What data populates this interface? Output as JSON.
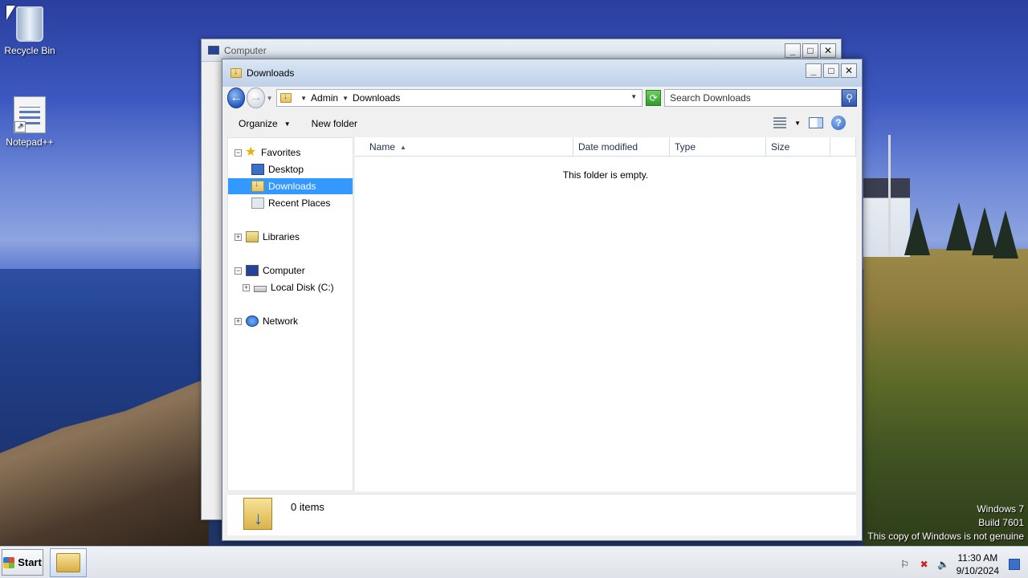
{
  "desktop": {
    "icons": [
      {
        "label": "Recycle Bin",
        "icon": "recycle-bin-icon"
      },
      {
        "label": "Notepad++",
        "icon": "notepad-plus-plus-icon"
      }
    ]
  },
  "background_window": {
    "title": "Computer"
  },
  "window": {
    "title": "Downloads",
    "breadcrumb": [
      "Admin",
      "Downloads"
    ],
    "search_placeholder": "Search Downloads",
    "toolbar": {
      "organize_label": "Organize",
      "new_folder_label": "New folder"
    },
    "nav_tree": {
      "favorites": "Favorites",
      "desktop": "Desktop",
      "downloads": "Downloads",
      "recent_places": "Recent Places",
      "libraries": "Libraries",
      "computer": "Computer",
      "local_disk": "Local Disk (C:)",
      "network": "Network"
    },
    "columns": [
      "Name",
      "Date modified",
      "Type",
      "Size"
    ],
    "empty_message": "This folder is empty.",
    "details": {
      "item_count": "0 items"
    }
  },
  "watermark": {
    "line1": "Windows 7",
    "line2": "Build 7601",
    "line3": "This copy of Windows is not genuine"
  },
  "taskbar": {
    "start_label": "Start",
    "time": "11:30 AM",
    "date": "9/10/2024"
  },
  "colors": {
    "selection": "#3399ff",
    "title_bar": "#c9d9ee",
    "taskbar": "#e6e9ee"
  }
}
